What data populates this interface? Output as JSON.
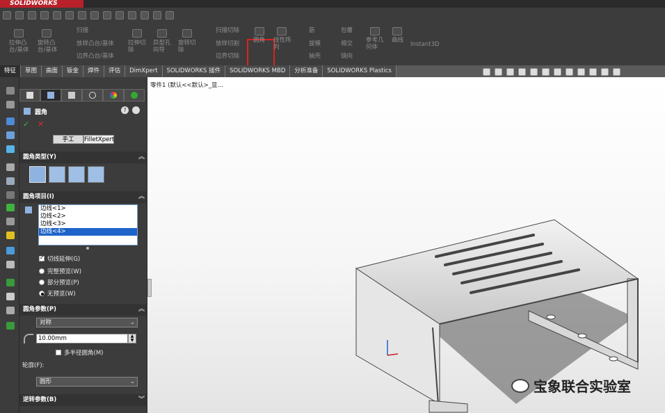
{
  "app": {
    "brand": "SOLIDWORKS"
  },
  "ribbon": {
    "extrude_boss": "拉伸凸\n台/基体",
    "revolve_boss": "旋转凸\n台/基体",
    "sweep": "扫描",
    "loft_boss": "放样凸台/基体",
    "boundary_boss": "边界凸台/基体",
    "extrude_cut": "拉伸切\n除",
    "hole_wizard": "异型孔\n向导",
    "revolve_cut": "旋转切\n除",
    "swept_cut": "扫描切除",
    "lofted_cut": "放样切割",
    "boundary_cut": "边界切除",
    "fillet": "圆角",
    "linear_pattern": "线性阵\n列",
    "rib": "筋",
    "draft": "拔模",
    "shell": "抽壳",
    "wrap": "包覆",
    "intersect": "相交",
    "mirror": "镜向",
    "ref_geometry": "参考几\n何体",
    "curves": "曲线",
    "instant3d": "Instant3D"
  },
  "tabs": [
    "特征",
    "草图",
    "曲面",
    "钣金",
    "焊件",
    "评估",
    "DimXpert",
    "SOLIDWORKS 插件",
    "SOLIDWORKS MBD",
    "分析准备",
    "SOLIDWORKS Plastics"
  ],
  "tree": {
    "root": "零件1 (默认<<默认>_显..."
  },
  "propertymanager": {
    "title": "圆角",
    "help": "?",
    "manual_tab": "手工",
    "filletxpert_tab": "FilletXpert",
    "sections": {
      "fillet_type": "圆角类型(Y)",
      "items": "圆角项目(I)",
      "params": "圆角参数(P)",
      "profile_label": "轮廓(F):",
      "reverse_params": "逆转参数(B)"
    },
    "edges": [
      "边线<1>",
      "边线<2>",
      "边线<3>",
      "边线<4>"
    ],
    "selected_edge_index": 3,
    "tangent_propagation": "切线延伸(G)",
    "tangent_checked": true,
    "preview_options": [
      "完整预览(W)",
      "部分预览(P)",
      "无预览(W)"
    ],
    "preview_selected": 2,
    "method": "对称",
    "radius": "10.00mm",
    "multi_radius": "多半径圆角(M)",
    "multi_radius_checked": false,
    "profile": "圆形"
  },
  "watermark": "宝象联合实验室",
  "colors": {
    "accent_red": "#e02020",
    "selection_blue": "#1e64c8"
  }
}
